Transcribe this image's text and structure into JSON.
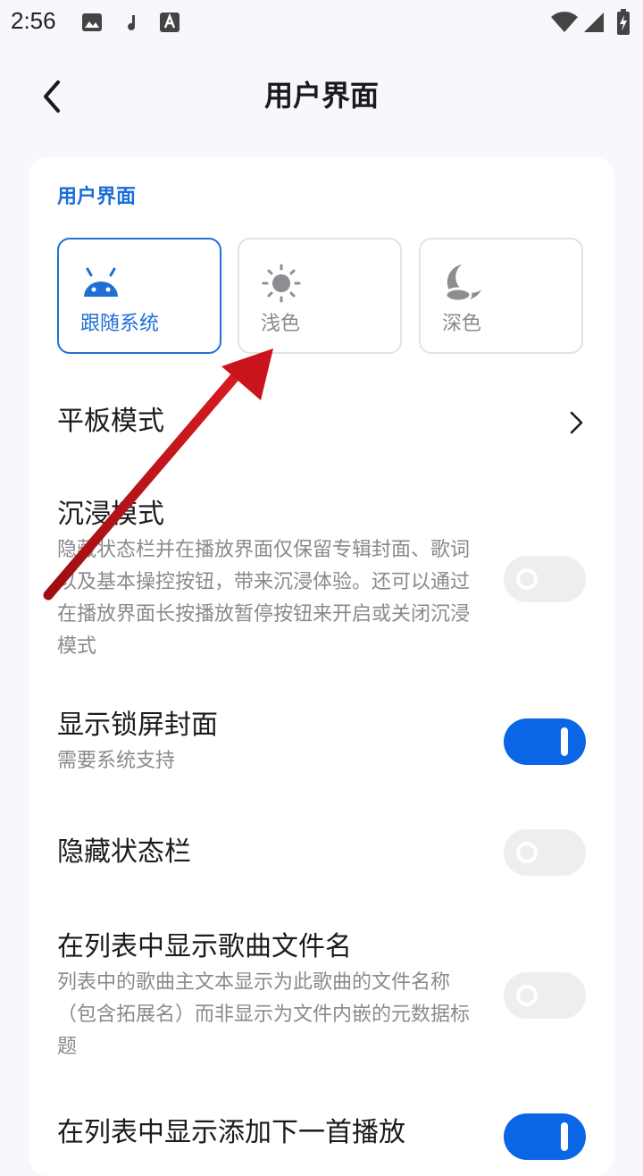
{
  "status_bar": {
    "time": "2:56",
    "icons": [
      "image-icon",
      "music-note-icon",
      "font-icon",
      "wifi-icon",
      "signal-icon",
      "battery-charging-icon"
    ]
  },
  "app_bar": {
    "title": "用户界面",
    "back_icon": "back-arrow-icon"
  },
  "theme_section": {
    "title": "用户界面",
    "options": [
      {
        "label": "跟随系统",
        "icon": "android-icon",
        "selected": true
      },
      {
        "label": "浅色",
        "icon": "sun-icon",
        "selected": false
      },
      {
        "label": "深色",
        "icon": "moon-icon",
        "selected": false
      }
    ]
  },
  "settings": [
    {
      "title": "平板模式",
      "type": "chevron"
    },
    {
      "title": "沉浸模式",
      "description": "隐藏状态栏并在播放界面仅保留专辑封面、歌词以及基本操控按钮，带来沉浸体验。还可以通过在播放界面长按播放暂停按钮来开启或关闭沉浸模式",
      "type": "toggle",
      "on": false
    },
    {
      "title": "显示锁屏封面",
      "description": "需要系统支持",
      "type": "toggle",
      "on": true
    },
    {
      "title": "隐藏状态栏",
      "type": "toggle",
      "on": false
    },
    {
      "title": "在列表中显示歌曲文件名",
      "description": "列表中的歌曲主文本显示为此歌曲的文件名称（包含拓展名）而非显示为文件内嵌的元数据标题",
      "type": "toggle",
      "on": false
    },
    {
      "title": "在列表中显示添加下一首播放",
      "type": "toggle",
      "on": true
    }
  ],
  "colors": {
    "accent": "#0a66e4",
    "toggle_off": "#eceef0",
    "arrow": "#c8141a"
  }
}
